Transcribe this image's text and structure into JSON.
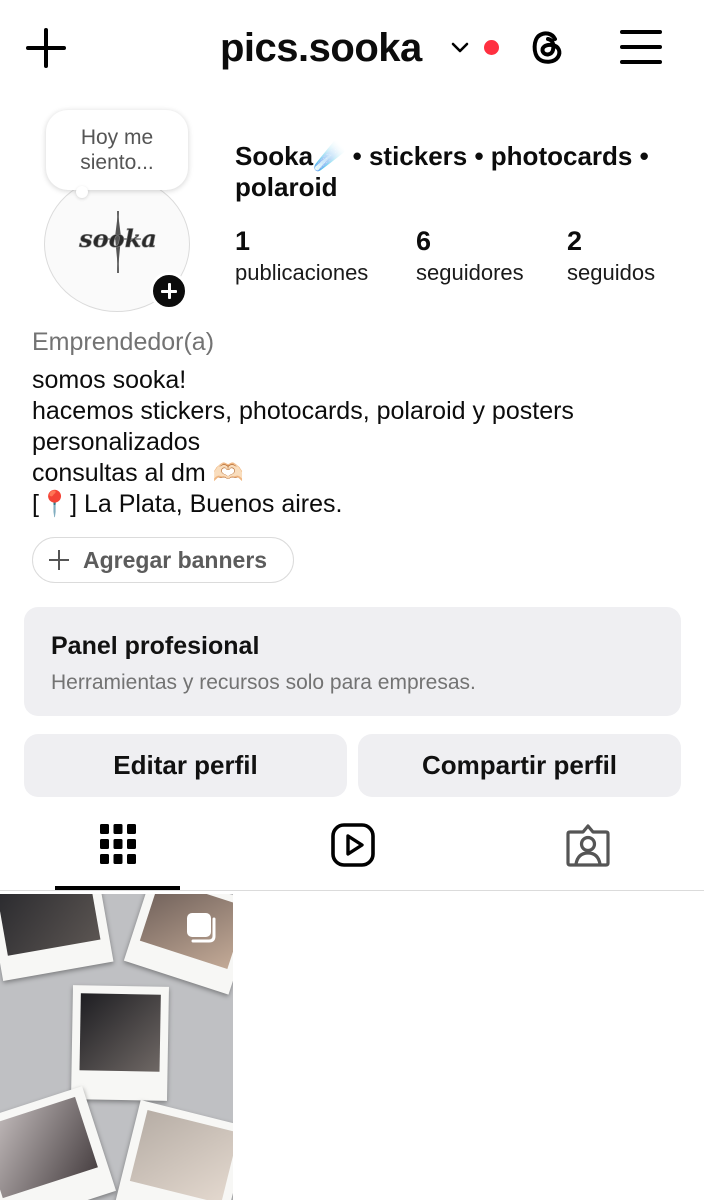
{
  "header": {
    "username": "pics.sooka",
    "icons": {
      "create": "plus-icon",
      "account_switch": "chevron-down-icon",
      "notification": "red-dot",
      "threads": "threads-icon",
      "menu": "hamburger-menu-icon"
    },
    "notification_color": "#ff3040"
  },
  "profile": {
    "note": "Hoy me siento...",
    "avatar_text": "sooka",
    "avatar_add_icon": "plus-icon",
    "display_name": "Sooka☄️ • stickers • photocards • polaroid",
    "stats": [
      {
        "value": "1",
        "label": "publicaciones"
      },
      {
        "value": "6",
        "label": "seguidores"
      },
      {
        "value": "2",
        "label": "seguidos"
      }
    ]
  },
  "bio": {
    "category": "Emprendedor(a)",
    "lines": [
      "somos sooka!",
      "hacemos stickers, photocards, polaroid y posters",
      "personalizados",
      "consultas al dm 🫶🏻",
      "[📍] La Plata, Buenos aires."
    ]
  },
  "banners_button": {
    "label": "Agregar banners",
    "icon": "plus-icon"
  },
  "professional_panel": {
    "title": "Panel profesional",
    "subtitle": "Herramientas y recursos solo para empresas."
  },
  "actions": {
    "edit": "Editar perfil",
    "share": "Compartir perfil"
  },
  "tabs": [
    {
      "name": "posts",
      "icon": "grid-icon",
      "active": true
    },
    {
      "name": "reels",
      "icon": "reels-icon",
      "active": false
    },
    {
      "name": "tagged",
      "icon": "tagged-person-icon",
      "active": false
    }
  ],
  "posts": [
    {
      "type": "carousel",
      "icon": "multiple-images-icon"
    }
  ]
}
